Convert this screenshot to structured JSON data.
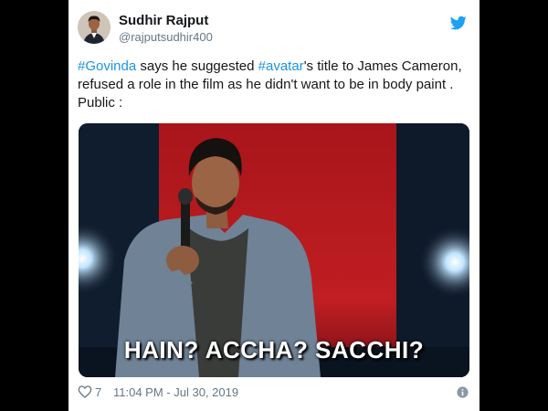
{
  "user": {
    "display_name": "Sudhir Rajput",
    "handle": "@rajputsudhir400"
  },
  "tweet": {
    "hashtag_1": "#Govinda",
    "text_1": " says he suggested ",
    "hashtag_2": "#avatar",
    "text_2": "'s title to James Cameron, refused a role in the film as he didn't want to be in body paint . Public :"
  },
  "media": {
    "caption": "HAIN? ACCHA?  SACCHI?"
  },
  "footer": {
    "like_count": "7",
    "timestamp": "11:04 PM - Jul 30, 2019"
  },
  "icons": {
    "brand": "twitter-bird-icon",
    "like": "heart-icon",
    "info": "info-icon"
  },
  "colors": {
    "link": "#1b95e0",
    "text": "#14171a",
    "muted": "#657786",
    "backdrop": "#000000",
    "stage_red": "#b0191d"
  }
}
